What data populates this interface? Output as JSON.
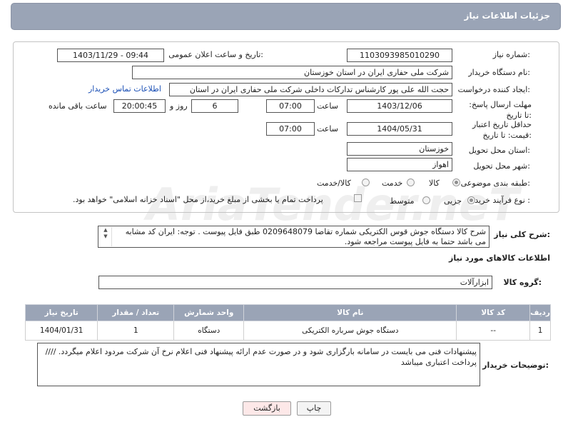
{
  "header": {
    "title": "جزئیات اطلاعات نیاز"
  },
  "form": {
    "need_number_label": "شماره نیاز:",
    "need_number": "1103093985010290",
    "announce_label": "تاریخ و ساعت اعلان عمومی:",
    "announce_value": "1403/11/29 - 09:44",
    "buyer_label": "نام دستگاه خریدار:",
    "buyer_value": "شرکت ملی حفاری ایران در استان خوزستان",
    "creator_label": "ایجاد کننده درخواست:",
    "creator_value": "حجت الله علی پور کارشناس تدارکات داخلی شرکت ملی حفاری ایران در استان",
    "contact_link": "اطلاعات تماس خریدار",
    "deadline_label": "مهلت ارسال پاسخ: تا تاریخ:",
    "deadline_date": "1403/12/06",
    "time_label": "ساعت",
    "deadline_time": "07:00",
    "days_value": "6",
    "days_label": "روز و",
    "remaining_time": "20:00:45",
    "remaining_label": "ساعت باقی مانده",
    "min_validity_label": "حداقل تاریخ اعتبار قیمت: تا تاریخ:",
    "validity_date": "1404/05/31",
    "validity_time": "07:00",
    "province_label": "استان محل تحویل:",
    "province_value": "خوزستان",
    "city_label": "شهر محل تحویل:",
    "city_value": "اهواز",
    "category_label": "طبقه بندی موضوعی:",
    "category_options": [
      "کالا",
      "خدمت",
      "کالا/خدمت"
    ],
    "purchase_label": "نوع فرآیند خرید :",
    "purchase_options": [
      "جزیی",
      "متوسط"
    ],
    "payment_note": "پرداخت تمام یا بخشی از مبلغ خرید،از محل \"اسناد خزانه اسلامی\" خواهد بود."
  },
  "description": {
    "label": "شرح کلی نیاز:",
    "text": "شرح کالا دستگاه جوش قوس الکتریکی شماره تقاضا 0209648079   طبق فایل پیوست . توجه: ایران کد مشابه می باشد حتما به فایل پیوست مراجعه شود."
  },
  "goods_section": {
    "title": "اطلاعات کالاهای مورد نیاز",
    "group_label": "گروه کالا:",
    "group_value": "ابزارآلات"
  },
  "table": {
    "headers": [
      "ردیف",
      "کد کالا",
      "نام کالا",
      "واحد شمارش",
      "تعداد / مقدار",
      "تاریخ نیاز"
    ],
    "rows": [
      [
        "1",
        "--",
        "دستگاه جوش سرباره الکتریکی",
        "دستگاه",
        "1",
        "1404/01/31"
      ]
    ]
  },
  "buyer_notes": {
    "label": "توضیحات خریدار:",
    "text": "پیشنهادات فنی می بایست در سامانه بارگزاری شود و در صورت عدم ارائه پیشنهاد فنی اعلام نرخ آن شرکت مردود اعلام میگردد.  //// پرداخت اعتباری میباشد"
  },
  "buttons": {
    "print": "چاپ",
    "back": "بازگشت"
  },
  "watermark": "AriaTender.neT",
  "colors": {
    "header_bg": "#9aa4b6",
    "link": "#1a4fb5",
    "back_button_bg": "#fde8e8"
  }
}
